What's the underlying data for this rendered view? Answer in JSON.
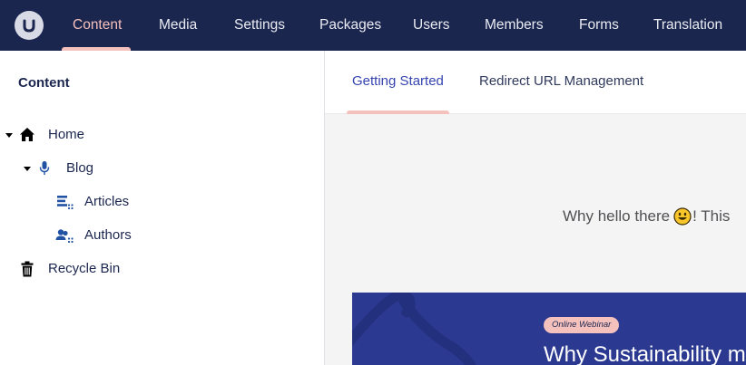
{
  "app": {
    "sections": [
      {
        "label": "Content",
        "active": true
      },
      {
        "label": "Media"
      },
      {
        "label": "Settings"
      },
      {
        "label": "Packages"
      },
      {
        "label": "Users"
      },
      {
        "label": "Members"
      },
      {
        "label": "Forms"
      },
      {
        "label": "Translation"
      }
    ],
    "logo_icon": "umbraco-logo-icon"
  },
  "sidebar": {
    "title": "Content",
    "tree": [
      {
        "label": "Home",
        "icon": "home-icon",
        "expanded": true
      },
      {
        "label": "Blog",
        "icon": "microphone-icon",
        "expanded": true
      },
      {
        "label": "Articles",
        "icon": "list-icon"
      },
      {
        "label": "Authors",
        "icon": "users-icon"
      },
      {
        "label": "Recycle Bin",
        "icon": "trash-icon"
      }
    ]
  },
  "dashboard": {
    "tabs": [
      {
        "label": "Getting Started",
        "active": true
      },
      {
        "label": "Redirect URL Management"
      }
    ],
    "greeting_before": "Why hello there",
    "greeting_after": "! This",
    "greeting_emoji": "smiley-emoji",
    "banner": {
      "badge": "Online Webinar",
      "title": "Why Sustainability m"
    }
  },
  "colors": {
    "topbar": "#1b264f",
    "accent": "#f5c1bc",
    "active_tab": "#3544b1",
    "banner": "#2b3991",
    "icon_blue": "#2152a3"
  }
}
